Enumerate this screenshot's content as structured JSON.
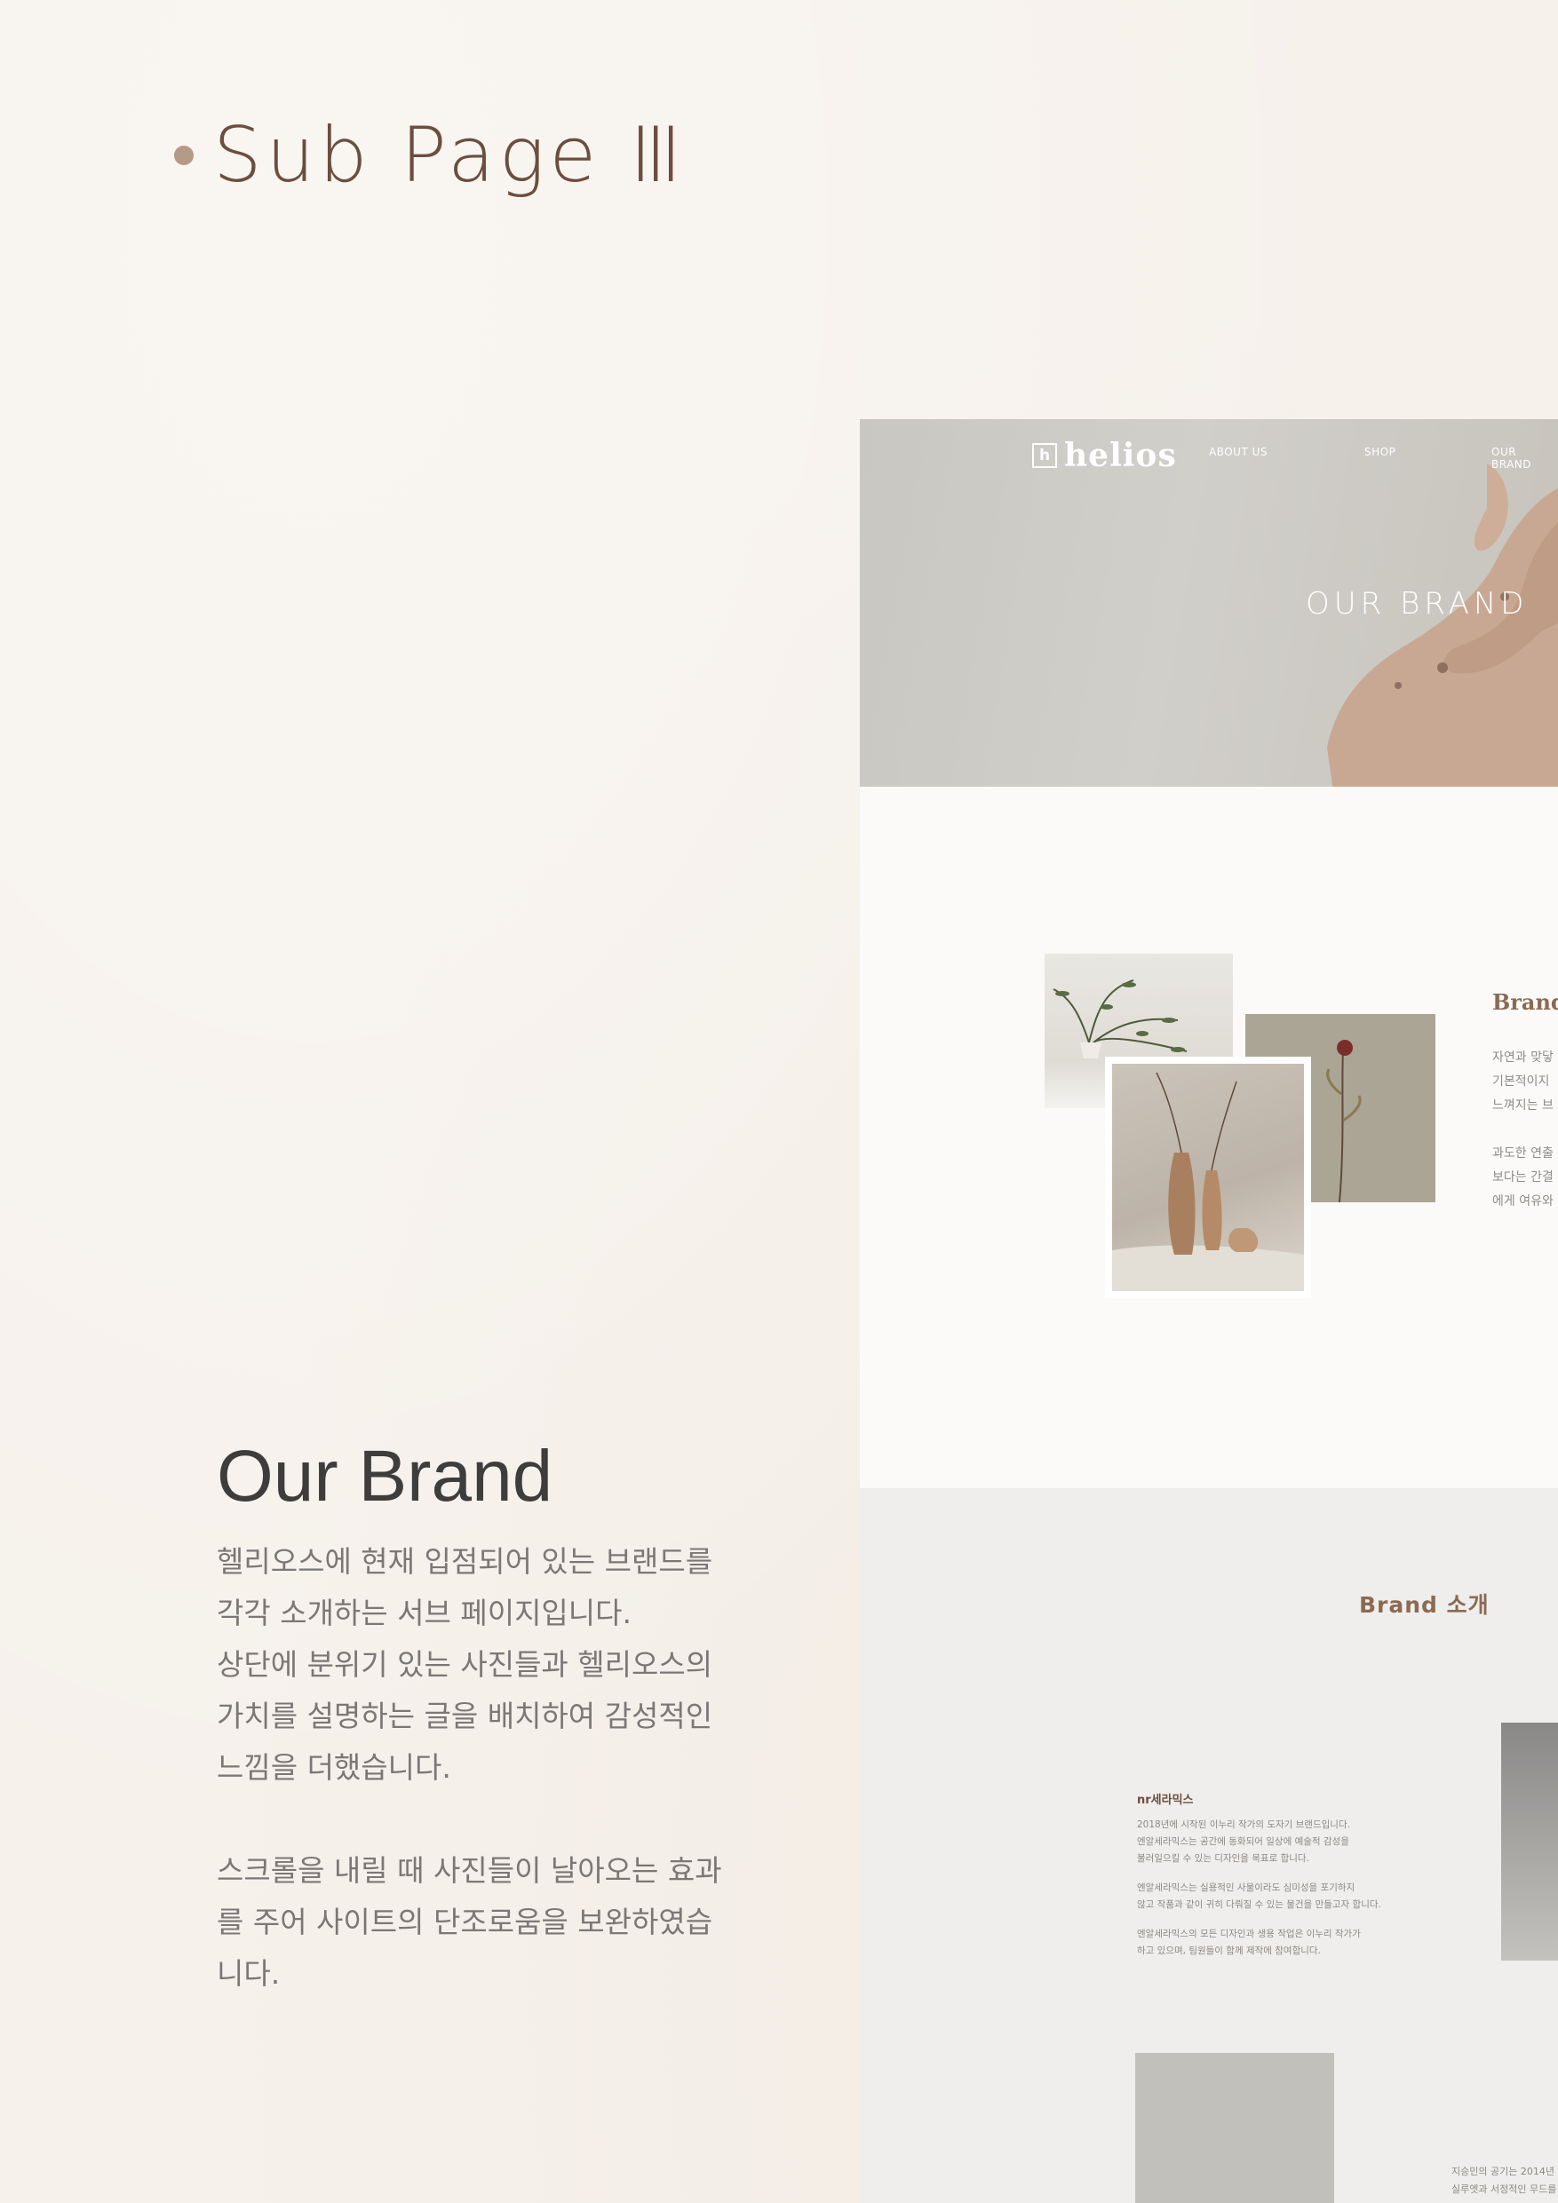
{
  "heading": {
    "title": "Sub Page Ⅲ"
  },
  "left": {
    "brand_title": "Our Brand",
    "paragraph1": [
      "헬리오스에 현재 입점되어 있는 브랜드를",
      "각각 소개하는 서브 페이지입니다.",
      "상단에 분위기 있는 사진들과 헬리오스의",
      "가치를 설명하는 글을 배치하여 감성적인",
      "느낌을 더했습니다."
    ],
    "paragraph2": [
      "스크롤을 내릴 때 사진들이 날아오는 효과",
      "를 주어 사이트의 단조로움을 보완하였습",
      "니다."
    ]
  },
  "mockup": {
    "logo_mark": "h",
    "logo_text": "helios",
    "nav": [
      "ABOUT US",
      "SHOP",
      "OUR BRAND"
    ],
    "hero_title": "OUR BRAND",
    "brand_small_title": "Brand",
    "brand_small_lines": [
      "자연과 맞닿",
      "기본적이지",
      "느껴지는 브",
      "",
      "과도한 연출",
      "보다는 간결",
      "에게 여유와"
    ],
    "brand_sokae": "Brand 소개",
    "ceram_name": "nr세라믹스",
    "ceram_lines": [
      "2018년에 시작된 이누리 작가의 도자기 브랜드입니다.",
      "엔알세라믹스는 공간에 동화되어 일상에 예술적 감성을",
      "불러일으킬 수 있는 디자인을 목표로 합니다.",
      "",
      "엔알세라믹스는 실용적인 사물이라도 심미성을 포기하지",
      "않고 작품과 같이 귀히 다뤄질 수 있는 물건을 만들고자 합니다.",
      "",
      "엔알세라믹스의 모든 디자인과 생용 작업은 이누리 작가가",
      "하고 있으며, 팀원들이 함께 제작에 참여합니다."
    ],
    "bottom_right_lines": [
      "지승민의 공기는 2014년",
      "실루엣과 서정적인 무드를"
    ]
  },
  "colors": {
    "background": "#f6f1eb",
    "accent": "#6b4e3f",
    "dot": "#b59a86"
  }
}
